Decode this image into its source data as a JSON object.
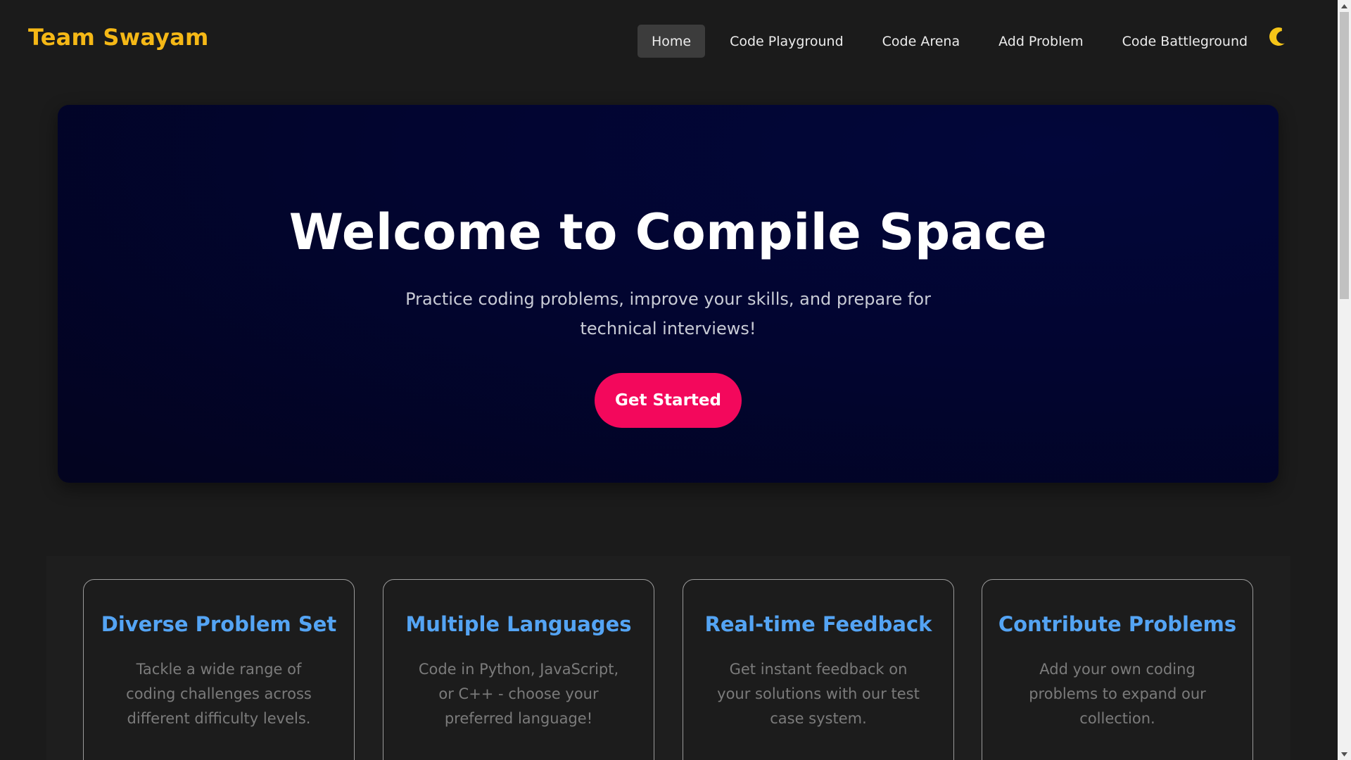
{
  "navbar": {
    "brand": "Team Swayam",
    "links": [
      {
        "label": "Home",
        "active": true
      },
      {
        "label": "Code Playground",
        "active": false
      },
      {
        "label": "Code Arena",
        "active": false
      },
      {
        "label": "Add Problem",
        "active": false
      },
      {
        "label": "Code Battleground",
        "active": false
      }
    ],
    "theme_toggle_icon": "crescent-moon-icon"
  },
  "hero": {
    "title": "Welcome to Compile Space",
    "subtitle": "Practice coding problems, improve your skills, and prepare for technical interviews!",
    "cta_label": "Get Started"
  },
  "features": [
    {
      "title": "Diverse Problem Set",
      "description": "Tackle a wide range of coding challenges across different difficulty levels."
    },
    {
      "title": "Multiple Languages",
      "description": "Code in Python, JavaScript, or C++ - choose your preferred language!"
    },
    {
      "title": "Real-time Feedback",
      "description": "Get instant feedback on your solutions with our test case system."
    },
    {
      "title": "Contribute Problems",
      "description": "Add your own coding problems to expand our collection."
    }
  ],
  "colors": {
    "brand": "#f5b816",
    "accent": "#f3085c",
    "feature_title": "#54a4f4",
    "background": "#1b1b1b",
    "hero_background": "#020530"
  }
}
